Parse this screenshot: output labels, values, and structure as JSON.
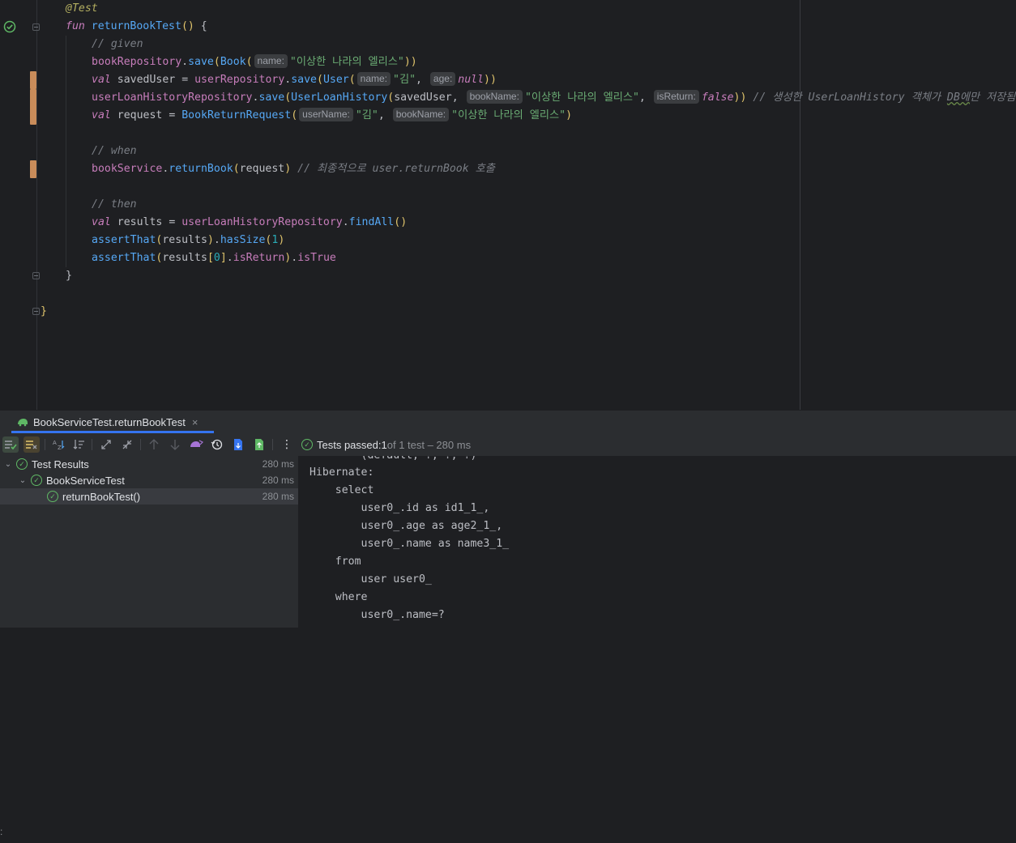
{
  "editor": {
    "lines": {
      "l1": "@Test",
      "fun": "fun",
      "fun_name": "returnBookTest",
      "cmt_given": "// given",
      "bookRepository": "bookRepository",
      "save": "save",
      "Book": "Book",
      "hint_name": "name:",
      "str_alice": "\"이상한 나라의 엘리스\"",
      "val": "val",
      "savedUser": "savedUser",
      "userRepository": "userRepository",
      "User": "User",
      "str_kim": "\"김\"",
      "hint_age": "age:",
      "null": "null",
      "userLoanHistoryRepository": "userLoanHistoryRepository",
      "UserLoanHistory": "UserLoanHistory",
      "hint_bookName": "bookName:",
      "hint_isReturn": "isReturn:",
      "false": "false",
      "cmt_created_pre": "// 생성한 UserLoanHistory 객체가 ",
      "cmt_created_db": "DB에",
      "cmt_created_post": "만 저장됨",
      "request": "request",
      "BookReturnRequest": "BookReturnRequest",
      "hint_userName": "userName:",
      "cmt_when": "// when",
      "bookService": "bookService",
      "returnBook": "returnBook",
      "cmt_finally": "// 최종적으로 user.returnBook 호출",
      "cmt_then": "// then",
      "results": "results",
      "findAll": "findAll",
      "assertThat": "assertThat",
      "hasSize": "hasSize",
      "one": "1",
      "zero": "0",
      "isReturn": "isReturn",
      "isTrue": "isTrue"
    }
  },
  "tool_window": {
    "tab_label": "BookServiceTest.returnBookTest",
    "close_glyph": "×",
    "status_prefix": "Tests passed: ",
    "status_count": "1",
    "status_suffix": " of 1 test – 280 ms",
    "tree": [
      {
        "label": "Test Results",
        "time": "280 ms"
      },
      {
        "label": "BookServiceTest",
        "time": "280 ms"
      },
      {
        "label": "returnBookTest()",
        "time": "280 ms"
      }
    ]
  },
  "console": {
    "lines": [
      "        (default, ?, ?, ?)",
      "Hibernate: ",
      "    select",
      "        user0_.id as id1_1_,",
      "        user0_.age as age2_1_,",
      "        user0_.name as name3_1_ ",
      "    from",
      "        user user0_ ",
      "    where",
      "        user0_.name=?"
    ]
  },
  "colors": {
    "accent": "#3574f0",
    "pass_green": "#5fb865",
    "change_marker": "#c98c5a"
  },
  "icons": [
    "run-passed-icon",
    "test-run-icon",
    "check-icon",
    "chevron-down-icon",
    "close-icon",
    "sort-alpha-icon",
    "sort-duration-icon",
    "expand-all-icon",
    "collapse-all-icon",
    "up-arrow-icon",
    "down-arrow-icon",
    "rerun-icon",
    "history-icon",
    "import-icon",
    "export-icon",
    "more-icon",
    "show-passed-icon",
    "show-ignored-icon"
  ]
}
